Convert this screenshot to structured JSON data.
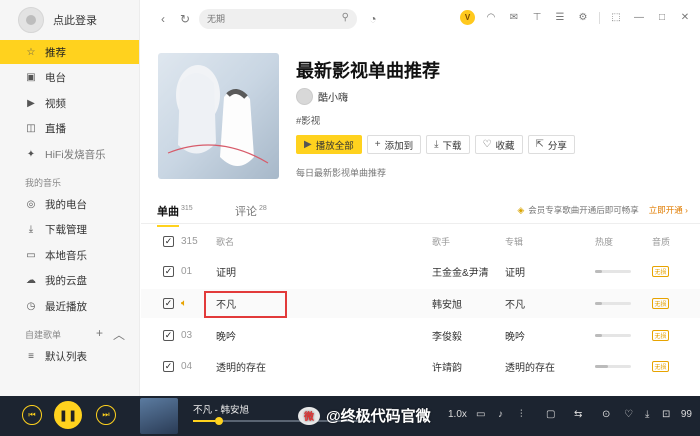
{
  "sidebar": {
    "login": "点此登录",
    "nav": [
      {
        "label": "推荐",
        "icon": "star-icon",
        "glyph": "☆",
        "active": true
      },
      {
        "label": "电台",
        "icon": "radio-icon",
        "glyph": "▣"
      },
      {
        "label": "视频",
        "icon": "video-icon",
        "glyph": "▶"
      },
      {
        "label": "直播",
        "icon": "live-icon",
        "glyph": "◫"
      },
      {
        "label": "HiFi发烧音乐",
        "icon": "hifi-icon",
        "glyph": "✦"
      }
    ],
    "section_my": "我的音乐",
    "my": [
      {
        "label": "我的电台",
        "icon": "my-radio-icon",
        "glyph": "◎"
      },
      {
        "label": "下载管理",
        "icon": "download-icon",
        "glyph": "⤓"
      },
      {
        "label": "本地音乐",
        "icon": "local-music-icon",
        "glyph": "▭"
      },
      {
        "label": "我的云盘",
        "icon": "cloud-icon",
        "glyph": "☁"
      },
      {
        "label": "最近播放",
        "icon": "recent-icon",
        "glyph": "◷"
      }
    ],
    "section_playlist": "自建歌单",
    "playlist": [
      {
        "label": "默认列表",
        "icon": "list-icon",
        "glyph": "≡"
      }
    ]
  },
  "topbar": {
    "search_placeholder": "无期"
  },
  "header": {
    "title": "最新影视单曲推荐",
    "creator": "酷小嗨",
    "tag": "#影视",
    "buttons": {
      "play_all": "播放全部",
      "add_to": "添加到",
      "download": "下载",
      "favorite": "收藏",
      "share": "分享"
    },
    "description": "每日最新影视单曲推荐"
  },
  "tabs": {
    "songs_label": "单曲",
    "songs_count": "315",
    "comments_label": "评论",
    "comments_count": "28",
    "promo": "会员专享歌曲开通后即可畅享",
    "promo_link": "立即开通 ›"
  },
  "table": {
    "header": {
      "count": "315",
      "name": "歌名",
      "artist": "歌手",
      "album": "专辑",
      "heat": "热度",
      "quality": "音质"
    },
    "rows": [
      {
        "num": "01",
        "name": "证明",
        "artist": "王金金&尹清",
        "album": "证明",
        "heat": 0.2,
        "quality": "无损"
      },
      {
        "num": "02",
        "name": "不凡",
        "artist": "韩安旭",
        "album": "不凡",
        "heat": 0.2,
        "quality": "无损",
        "playing": true
      },
      {
        "num": "03",
        "name": "晚吟",
        "artist": "李俊毅",
        "album": "晚吟",
        "heat": 0.2,
        "quality": "无损"
      },
      {
        "num": "04",
        "name": "透明的存在",
        "artist": "许靖韵",
        "album": "透明的存在",
        "heat": 0.35,
        "quality": "无损"
      }
    ]
  },
  "player": {
    "now_playing": "不凡 - 韩安旭",
    "progress": 0.12,
    "watermark": "@终极代码官微",
    "speed": "1.0x",
    "count": "99"
  }
}
